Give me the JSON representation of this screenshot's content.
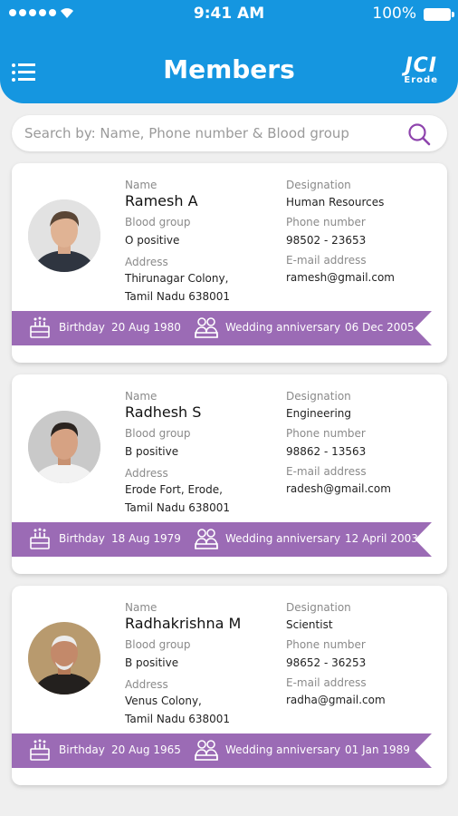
{
  "status_bar": {
    "time": "9:41 AM",
    "battery": "100%"
  },
  "header": {
    "title": "Members",
    "logo_main": "JCI",
    "logo_sub": "Erode"
  },
  "search": {
    "placeholder": "Search by: Name, Phone number & Blood group"
  },
  "labels": {
    "name": "Name",
    "blood_group": "Blood group",
    "address": "Address",
    "designation": "Designation",
    "phone": "Phone number",
    "email": "E-mail address",
    "birthday": "Birthday",
    "wedding": "Wedding anniversary"
  },
  "members": [
    {
      "name": "Ramesh A",
      "blood_group": "O positive",
      "address_line1": "Thirunagar Colony,",
      "address_line2": "Tamil Nadu 638001",
      "designation": "Human Resources",
      "phone": "98502 - 23653",
      "email": "ramesh@gmail.com",
      "birthday": "20 Aug 1980",
      "wedding": "06 Dec 2005"
    },
    {
      "name": "Radhesh S",
      "blood_group": "B positive",
      "address_line1": "Erode Fort, Erode,",
      "address_line2": "Tamil Nadu 638001",
      "designation": "Engineering",
      "phone": "98862 - 13563",
      "email": "radesh@gmail.com",
      "birthday": "18 Aug 1979",
      "wedding": "12 April 2003"
    },
    {
      "name": "Radhakrishna M",
      "blood_group": "B positive",
      "address_line1": "Venus Colony,",
      "address_line2": "Tamil Nadu 638001",
      "designation": "Scientist",
      "phone": "98652 - 36253",
      "email": "radha@gmail.com",
      "birthday": "20 Aug 1965",
      "wedding": "01 Jan 1989"
    }
  ],
  "colors": {
    "header": "#1596e0",
    "ribbon": "#9b6bb5",
    "accent": "#8e44ad"
  },
  "icons": [
    "signal-icon",
    "wifi-icon",
    "battery-icon",
    "menu-icon",
    "search-icon",
    "cake-icon",
    "couple-icon"
  ]
}
